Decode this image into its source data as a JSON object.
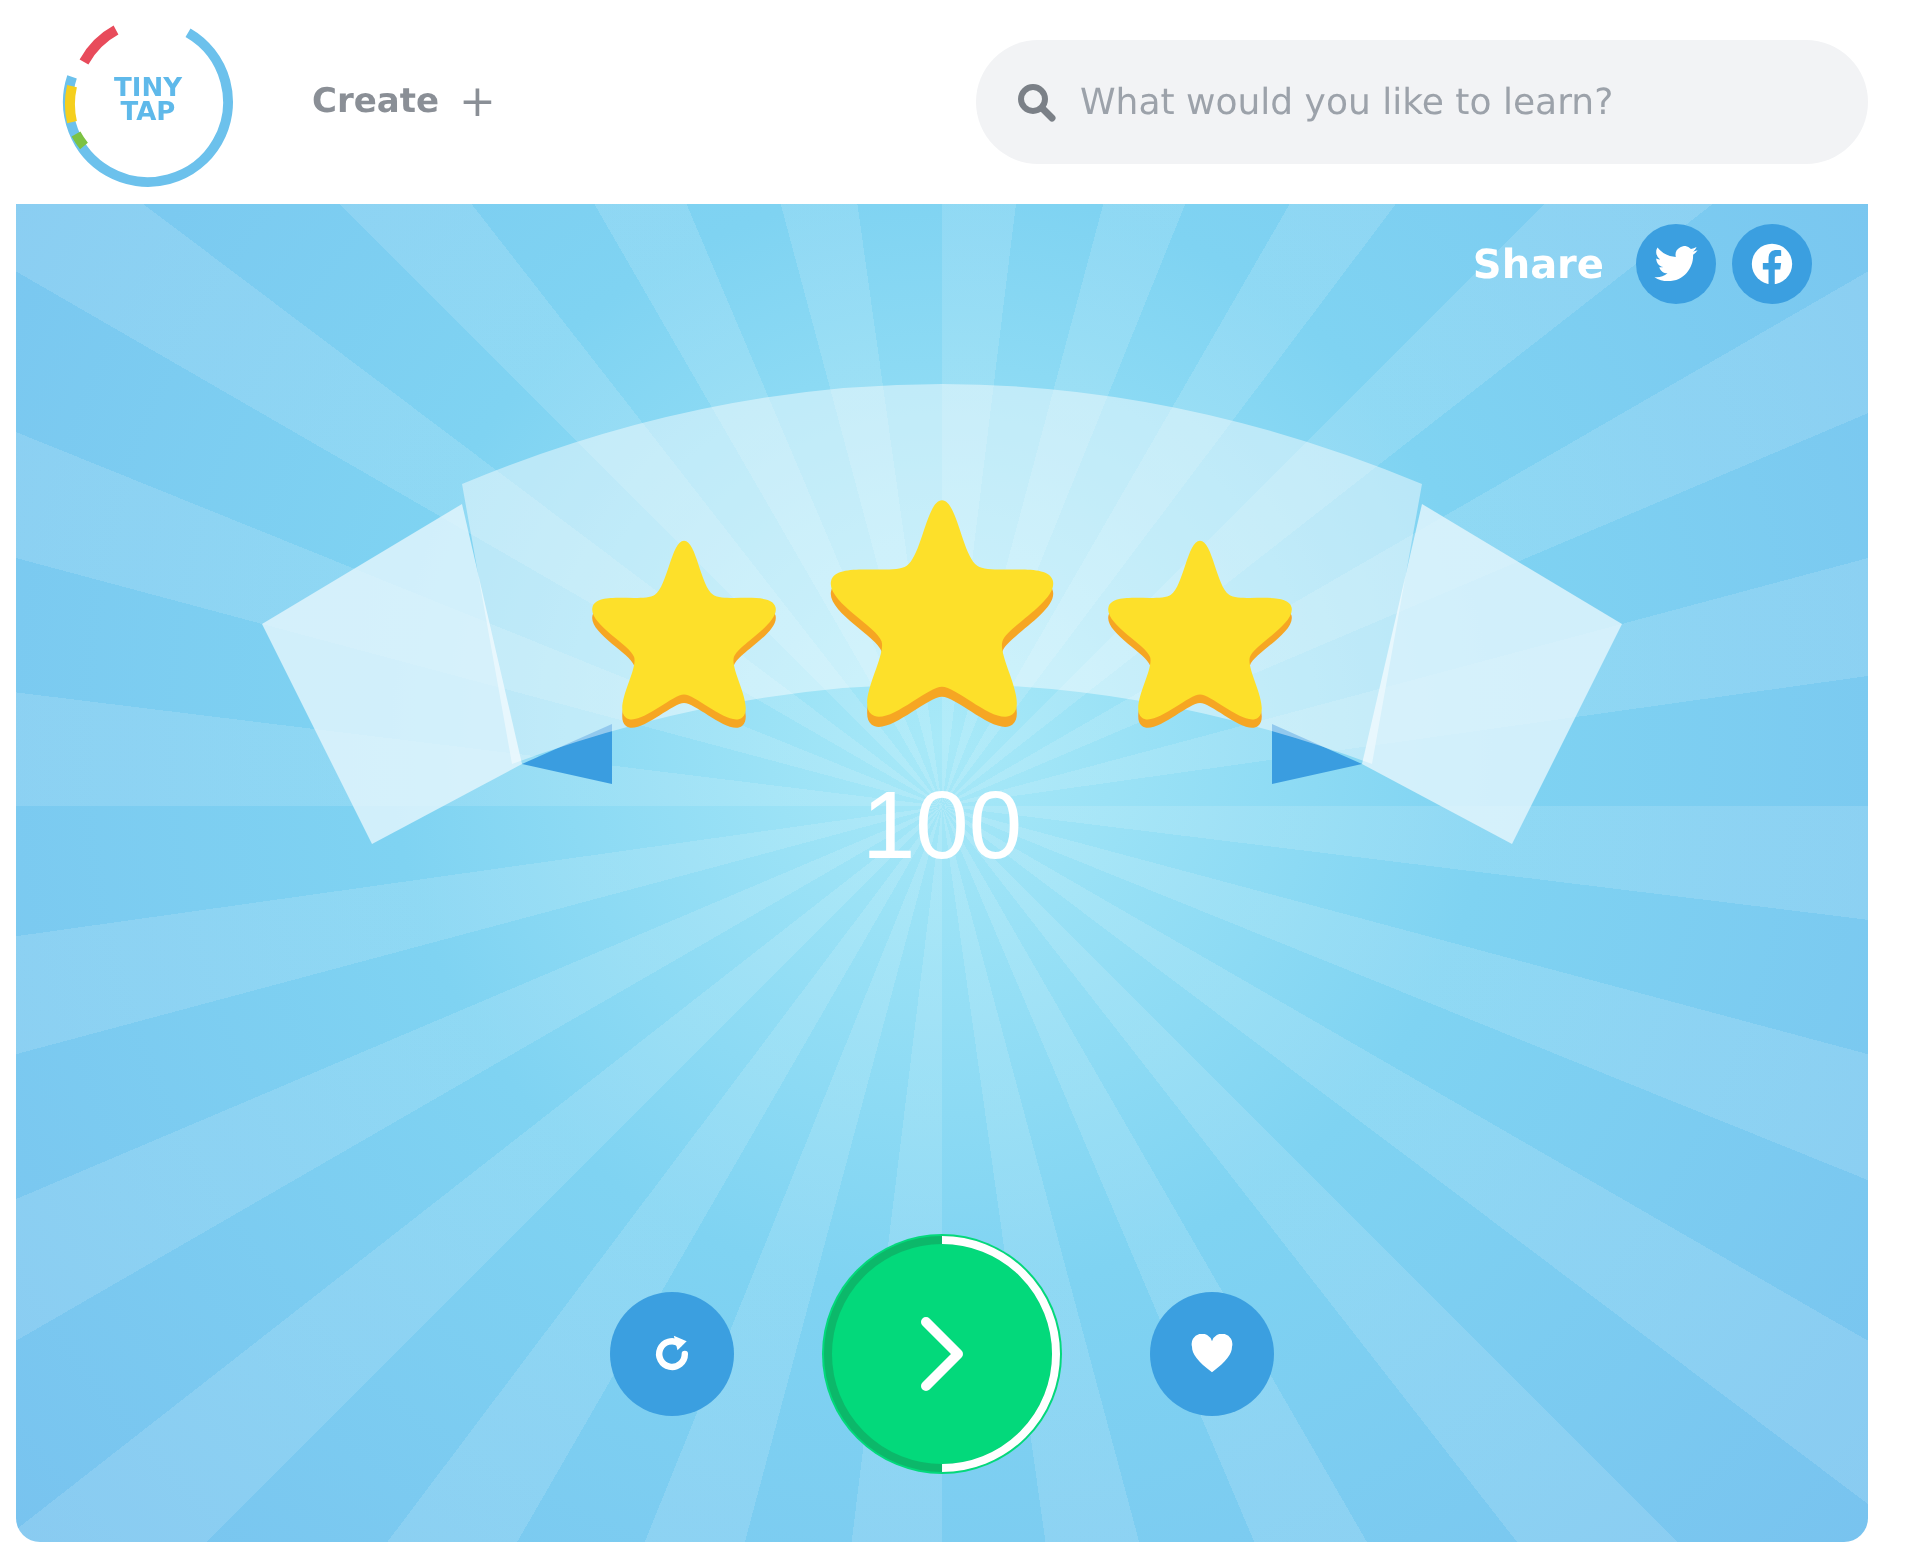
{
  "header": {
    "logo": [
      "TINY",
      "TAP"
    ],
    "create": "Create",
    "create_icon": "+",
    "search": {
      "placeholder": "What would you like to learn?"
    }
  },
  "share": {
    "label": "Share"
  },
  "result": {
    "stars": 3,
    "score": "100"
  },
  "next_button": {
    "level": 0.5
  }
}
